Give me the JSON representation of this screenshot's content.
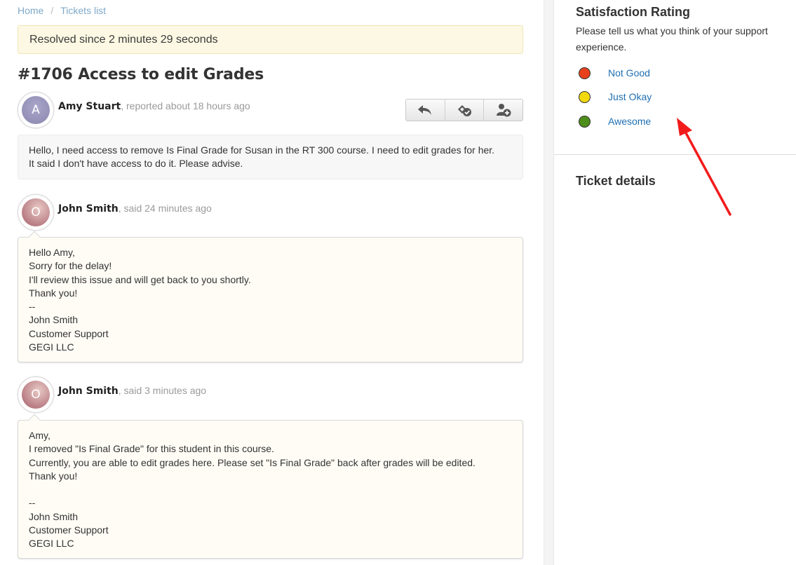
{
  "breadcrumb": {
    "home": "Home",
    "separator": "/",
    "current": "Tickets list"
  },
  "status_alert": "Resolved since 2 minutes 29 seconds",
  "ticket": {
    "title": "#1706 Access to edit Grades"
  },
  "toolbar": {
    "icons": [
      "reply-icon",
      "resolve-icon",
      "assign-user-icon"
    ]
  },
  "posts": [
    {
      "avatar_letter": "A",
      "author": "Amy Stuart",
      "meta": ", reported about 18 hours ago",
      "lines": [
        "Hello, I need access to remove Is Final Grade for Susan in the RT 300 course. I need to edit grades for her.",
        "It said I don't have access to do it. Please advise."
      ]
    },
    {
      "avatar_letter": "O",
      "author": "John Smith",
      "meta": ", said 24 minutes ago",
      "lines": [
        "Hello Amy,",
        "Sorry for the delay!",
        "I'll review this issue and will get back to you shortly.",
        "Thank you!",
        "--",
        "John Smith",
        "Customer Support",
        "GEGI LLC"
      ]
    },
    {
      "avatar_letter": "O",
      "author": "John Smith",
      "meta": ", said 3 minutes ago",
      "lines": [
        "Amy,",
        "I removed \"Is Final Grade\" for this student in this course.",
        "Currently, you are able to edit grades here. Please set \"Is Final Grade\" back after grades will be edited.",
        "Thank you!",
        "",
        "--",
        "John Smith",
        "Customer Support",
        "GEGI LLC"
      ]
    }
  ],
  "sidebar": {
    "satisfaction_title": "Satisfaction Rating",
    "satisfaction_desc": "Please tell us what you think of your support experience.",
    "ratings": [
      {
        "label": "Not Good",
        "color": "#e8401c"
      },
      {
        "label": "Just Okay",
        "color": "#f2d90e"
      },
      {
        "label": "Awesome",
        "color": "#4e8e1a"
      }
    ],
    "details_title": "Ticket details"
  },
  "colors": {
    "link": "#1f6fb2",
    "breadcrumb": "#7fa9c8",
    "alert_bg": "#fcf8e3",
    "annotation_arrow": "#f21b1b"
  }
}
